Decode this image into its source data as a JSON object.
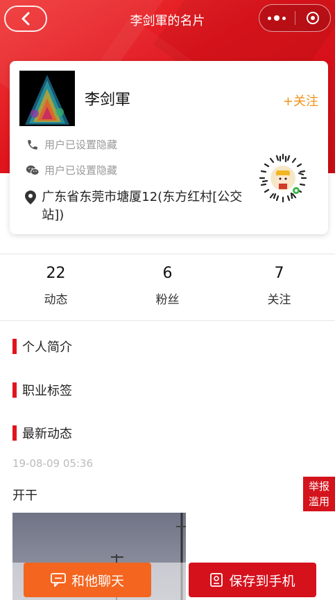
{
  "nav": {
    "title": "李剑軍的名片",
    "back_icon": "chevron-left-icon",
    "more_icon": "more-dots-icon",
    "close_icon": "target-circle-icon"
  },
  "profile": {
    "name": "李剑軍",
    "follow_label": "+关注",
    "phone": "用户已设置隐藏",
    "wechat": "用户已设置隐藏",
    "address": "广东省东莞市塘厦12(东方红村[公交站])"
  },
  "stats": [
    {
      "value": "22",
      "label": "动态"
    },
    {
      "value": "6",
      "label": "粉丝"
    },
    {
      "value": "7",
      "label": "关注"
    }
  ],
  "sections": {
    "intro": "个人简介",
    "tags": "职业标签",
    "latest": "最新动态"
  },
  "post": {
    "time": "19-08-09 05:36",
    "text": "开干"
  },
  "report": {
    "line1": "举报",
    "line2": "滥用"
  },
  "buttons": {
    "chat": "和他聊天",
    "save": "保存到手机"
  },
  "colors": {
    "brand_red": "#e0141c",
    "orange": "#f4651f",
    "follow_orange": "#f29219"
  }
}
